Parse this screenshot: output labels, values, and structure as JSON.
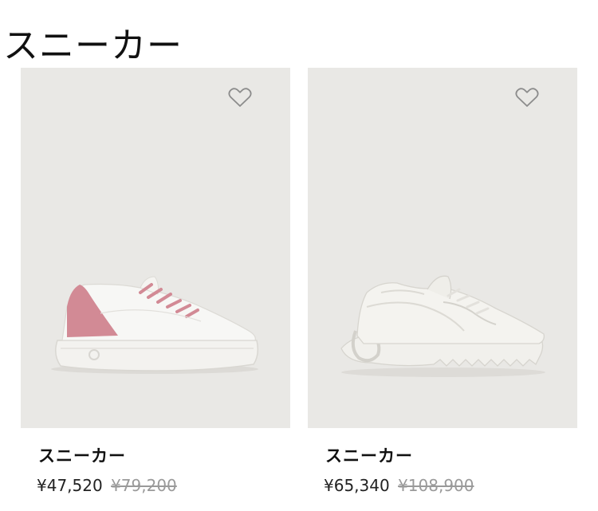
{
  "category": {
    "title": "スニーカー"
  },
  "products": [
    {
      "name": "スニーカー",
      "price_sale": "¥47,520",
      "price_original": "¥79,200",
      "favorite_icon": "heart-outline-icon",
      "image_bg": "#e9e8e5",
      "accent_color": "#d28a95"
    },
    {
      "name": "スニーカー",
      "price_sale": "¥65,340",
      "price_original": "¥108,900",
      "favorite_icon": "heart-outline-icon",
      "image_bg": "#e9e8e5",
      "accent_color": "#f1f0ec"
    }
  ]
}
